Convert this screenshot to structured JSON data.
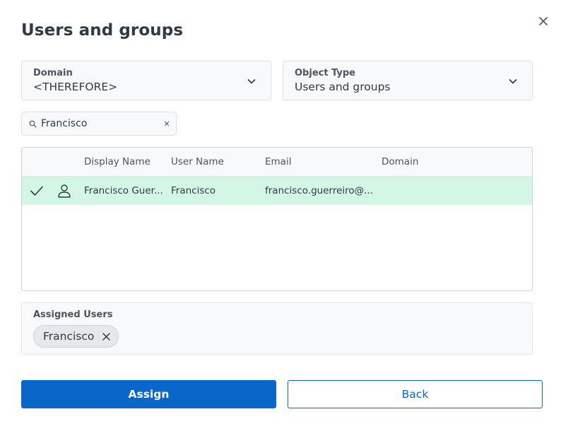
{
  "dialog": {
    "title": "Users and groups"
  },
  "filters": {
    "domain": {
      "label": "Domain",
      "value": "<THEREFORE>"
    },
    "object_type": {
      "label": "Object Type",
      "value": "Users and groups"
    }
  },
  "search": {
    "value": "Francisco"
  },
  "table": {
    "columns": [
      "Display Name",
      "User Name",
      "Email",
      "Domain"
    ],
    "rows": [
      {
        "selected": true,
        "type_icon": "person-icon",
        "display_name": "Francisco Guer...",
        "user_name": "Francisco",
        "email": "francisco.guerreiro@...",
        "domain": ""
      }
    ]
  },
  "assigned": {
    "label": "Assigned Users",
    "chips": [
      "Francisco"
    ]
  },
  "actions": {
    "assign_label": "Assign",
    "back_label": "Back"
  },
  "colors": {
    "primary": "#0a66c8",
    "selected_row": "#d3f7e4"
  }
}
